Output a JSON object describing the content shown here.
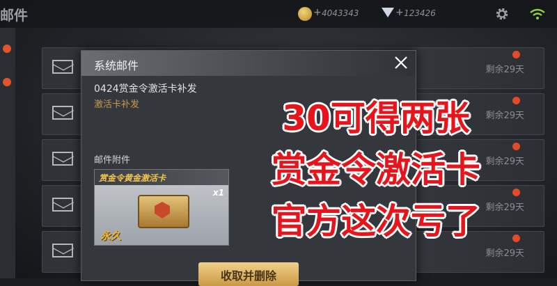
{
  "topbar": {
    "title": "邮件",
    "coins": "4043343",
    "gems": "123426"
  },
  "mail_list": {
    "rows": [
      {
        "remaining": "剩余29天"
      },
      {
        "remaining": "剩余29天"
      },
      {
        "remaining": "剩余29天"
      },
      {
        "remaining": "剩余29天"
      },
      {
        "remaining": "剩余29天"
      }
    ]
  },
  "modal": {
    "title": "系统邮件",
    "subject": "0424赏金令激活卡补发",
    "subtitle": "激活卡补发",
    "attachments_label": "邮件附件",
    "item": {
      "name": "赏金令黄金激活卡",
      "quantity": "x1",
      "duration": "永久"
    },
    "claim_button": "收取并删除"
  },
  "caption": {
    "line1": "30可得两张",
    "line2": "赏金令激活卡",
    "line3": "官方这次亏了"
  },
  "colors": {
    "caption_red": "#e8141b",
    "item_gold": "#f3c64c",
    "badge_red": "#e24a28"
  }
}
